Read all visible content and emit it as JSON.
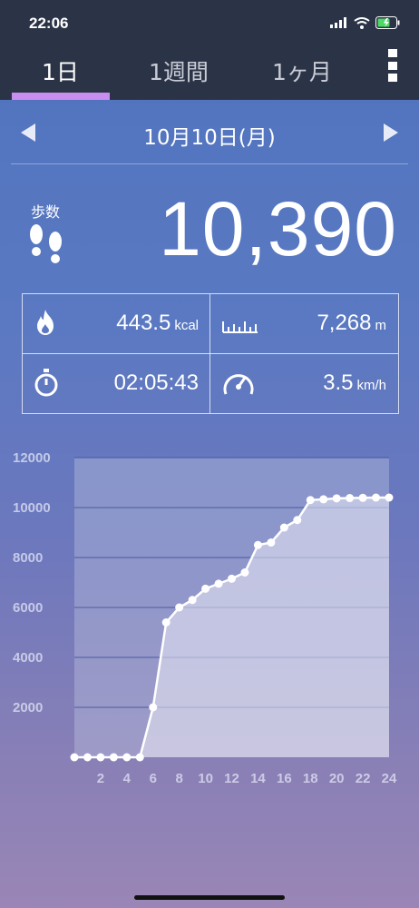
{
  "status_bar": {
    "time": "22:06"
  },
  "tabs": [
    {
      "label": "1日",
      "active": true
    },
    {
      "label": "1週間",
      "active": false
    },
    {
      "label": "1ヶ月",
      "active": false
    }
  ],
  "date": {
    "label": "10月10日(月)"
  },
  "steps": {
    "label": "歩数",
    "value": "10,390"
  },
  "stats": {
    "calories": {
      "value": "443.5",
      "unit": "kcal"
    },
    "distance": {
      "value": "7,268",
      "unit": "m"
    },
    "duration": {
      "value": "02:05:43"
    },
    "speed": {
      "value": "3.5",
      "unit": "km/h"
    }
  },
  "colors": {
    "tab_indicator": "#c78ef0",
    "top_bar": "#2b3446"
  },
  "chart_data": {
    "type": "area",
    "x": [
      0,
      1,
      2,
      3,
      4,
      5,
      6,
      7,
      8,
      9,
      10,
      11,
      12,
      13,
      14,
      15,
      16,
      17,
      18,
      19,
      20,
      21,
      22,
      23,
      24
    ],
    "values": [
      0,
      0,
      0,
      0,
      0,
      0,
      2000,
      5400,
      6000,
      6300,
      6750,
      6950,
      7150,
      7400,
      8500,
      8600,
      9200,
      9500,
      10300,
      10330,
      10370,
      10380,
      10390,
      10400,
      10400
    ],
    "xticks": [
      "2",
      "4",
      "6",
      "8",
      "10",
      "12",
      "14",
      "16",
      "18",
      "20",
      "22",
      "24"
    ],
    "yticks": [
      "2000",
      "4000",
      "6000",
      "8000",
      "10000",
      "12000"
    ],
    "ylim": [
      0,
      12000
    ],
    "xlim": [
      0,
      24
    ],
    "grid": true
  }
}
